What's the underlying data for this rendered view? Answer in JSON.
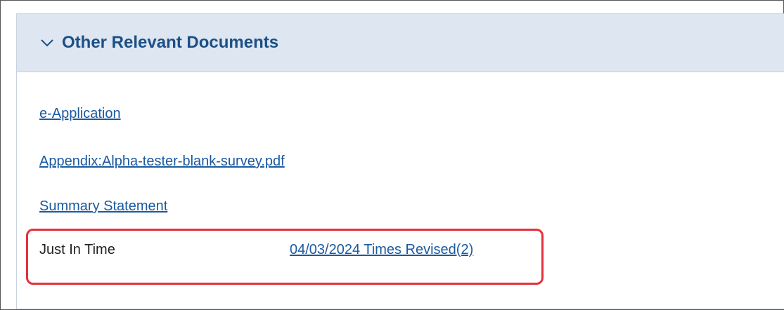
{
  "section": {
    "title": "Other Relevant Documents",
    "expanded": true,
    "icon": "chevron-down-icon"
  },
  "documents": [
    {
      "label": "e-Application"
    },
    {
      "label": "Appendix:Alpha-tester-blank-survey.pdf"
    },
    {
      "label": "Summary Statement"
    }
  ],
  "just_in_time": {
    "label": "Just In Time",
    "link_text": "04/03/2024 Times Revised(2)",
    "highlight_color": "#e3313b"
  },
  "colors": {
    "header_bg": "#dde6f1",
    "title": "#1c4f86",
    "link": "#1b5aa0"
  }
}
